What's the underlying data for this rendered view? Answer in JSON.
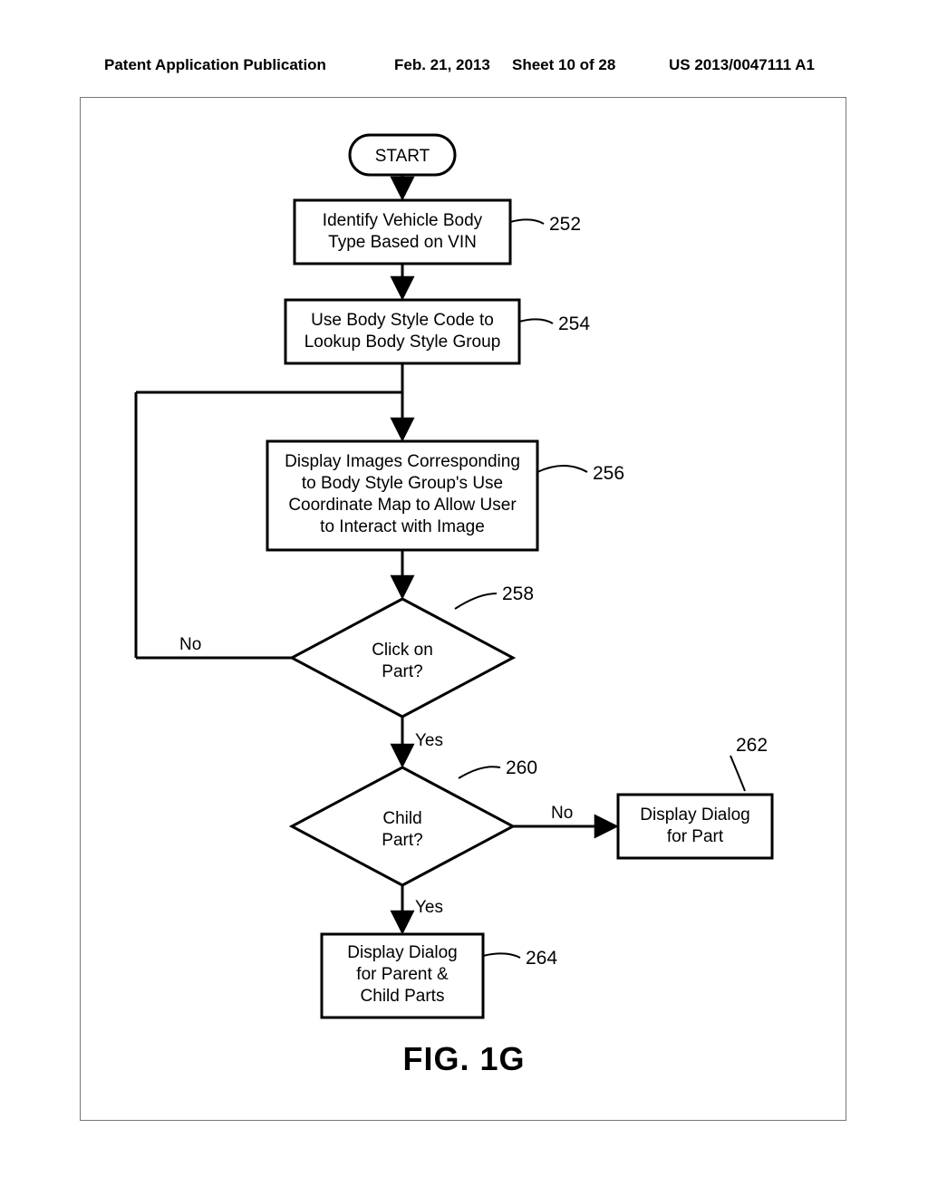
{
  "header": {
    "pub_type": "Patent Application Publication",
    "pub_date": "Feb. 21, 2013",
    "sheet": "Sheet 10 of 28",
    "pub_num": "US 2013/0047111 A1"
  },
  "figure": {
    "caption": "FIG. 1G"
  },
  "nodes": {
    "start": {
      "label": "START"
    },
    "n252": {
      "line1": "Identify Vehicle Body",
      "line2": "Type Based on VIN",
      "ref": "252"
    },
    "n254": {
      "line1": "Use Body Style Code to",
      "line2": "Lookup Body Style Group",
      "ref": "254"
    },
    "n256": {
      "line1": "Display Images Corresponding",
      "line2": "to Body Style Group's Use",
      "line3": "Coordinate Map to Allow User",
      "line4": "to Interact with Image",
      "ref": "256"
    },
    "n258": {
      "line1": "Click on",
      "line2": "Part?",
      "ref": "258"
    },
    "n260": {
      "line1": "Child",
      "line2": "Part?",
      "ref": "260"
    },
    "n262": {
      "line1": "Display Dialog",
      "line2": "for Part",
      "ref": "262"
    },
    "n264": {
      "line1": "Display Dialog",
      "line2": "for Parent &",
      "line3": "Child Parts",
      "ref": "264"
    }
  },
  "edges": {
    "e258_no": "No",
    "e258_yes": "Yes",
    "e260_no": "No",
    "e260_yes": "Yes"
  }
}
